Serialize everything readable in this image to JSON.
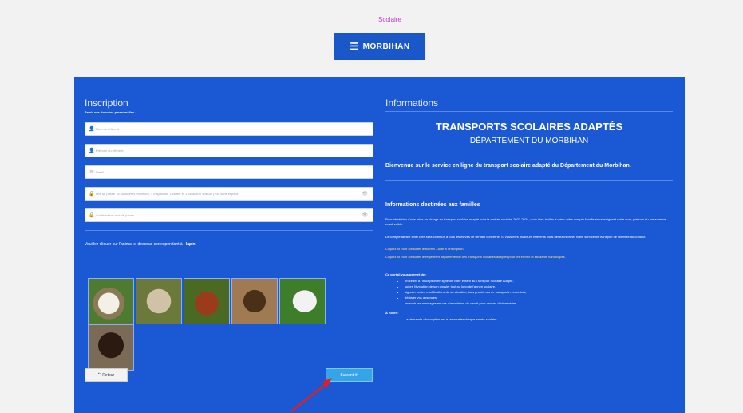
{
  "header": {
    "link_text": "Scolaire",
    "logo_text": "MORBIHAN"
  },
  "inscription": {
    "title": "Inscription",
    "subtitle": "Saisir vos données personnelles :",
    "fields": [
      {
        "placeholder": "Nom du référent",
        "icon": "user-icon"
      },
      {
        "placeholder": "Prénom du référent",
        "icon": "user-icon"
      },
      {
        "placeholder": "Email",
        "icon": "mail-icon"
      },
      {
        "placeholder": "Mot de passe : 8 caractères minimum, 1 majuscule, 1 chiffre et 1 caractère spécial (?!$) sans espace",
        "icon": "lock-icon"
      },
      {
        "placeholder": "Confirmation mot de passe",
        "icon": "lock-icon"
      }
    ],
    "captcha_instruction": "Veuillez cliquer sur l'animal ci-dessous correspondant à :",
    "captcha_target": "lapin",
    "back_label": "Retour",
    "next_label": "Suivant"
  },
  "informations": {
    "title": "Informations",
    "main_title": "TRANSPORTS SCOLAIRES ADAPTÉS",
    "main_subtitle": "DÉPARTEMENT DU MORBIHAN",
    "welcome": "Bienvenue sur le service en ligne du transport scolaire adapté du Département du Morbihan.",
    "families_title": "Informations destinées aux familles",
    "paragraph1": "Pour bénéficier d'une prise en charge au transport scolaire adapté pour la rentrée scolaire 2023-2024, vous êtes invités à créer votre compte famille en renseignant votre nom, prénom et une adresse email valide.",
    "paragraph2": "Le compte famille ainsi créé sera commun à tous les élèves de l'enfant concerné. Si vous êtes plusieurs référents vous devez informer notre service de transport de l'identité du contact.",
    "yellow1": "Cliquez ici pour consulter le tutoriel - Aide à l'inscription.",
    "yellow2": "Cliquez ici pour consulter le règlement départemental des transports scolaires adaptés pour les élèves et étudiants handicapés.",
    "portal_title": "Ce portail vous permet de :",
    "portal_items": [
      "procéder à l'inscription en ligne de votre enfant au Transport Scolaire Adapté,",
      "suivre l'évolution de son dossier tout au long de l'année scolaire,",
      "signaler toutes modifications de sa situation, tous problèmes de transports rencontrés,",
      "déclarer vos absences,",
      "recevoir les messages en cas d'annulation de circuit pour causes d'intempéries."
    ],
    "note_title": "À noter :",
    "note_items": [
      "La demande d'inscription est à renouveler chaque année scolaire."
    ]
  },
  "captcha_images": [
    "dog",
    "sheep",
    "hen",
    "bear",
    "rabbit",
    "monkey"
  ]
}
